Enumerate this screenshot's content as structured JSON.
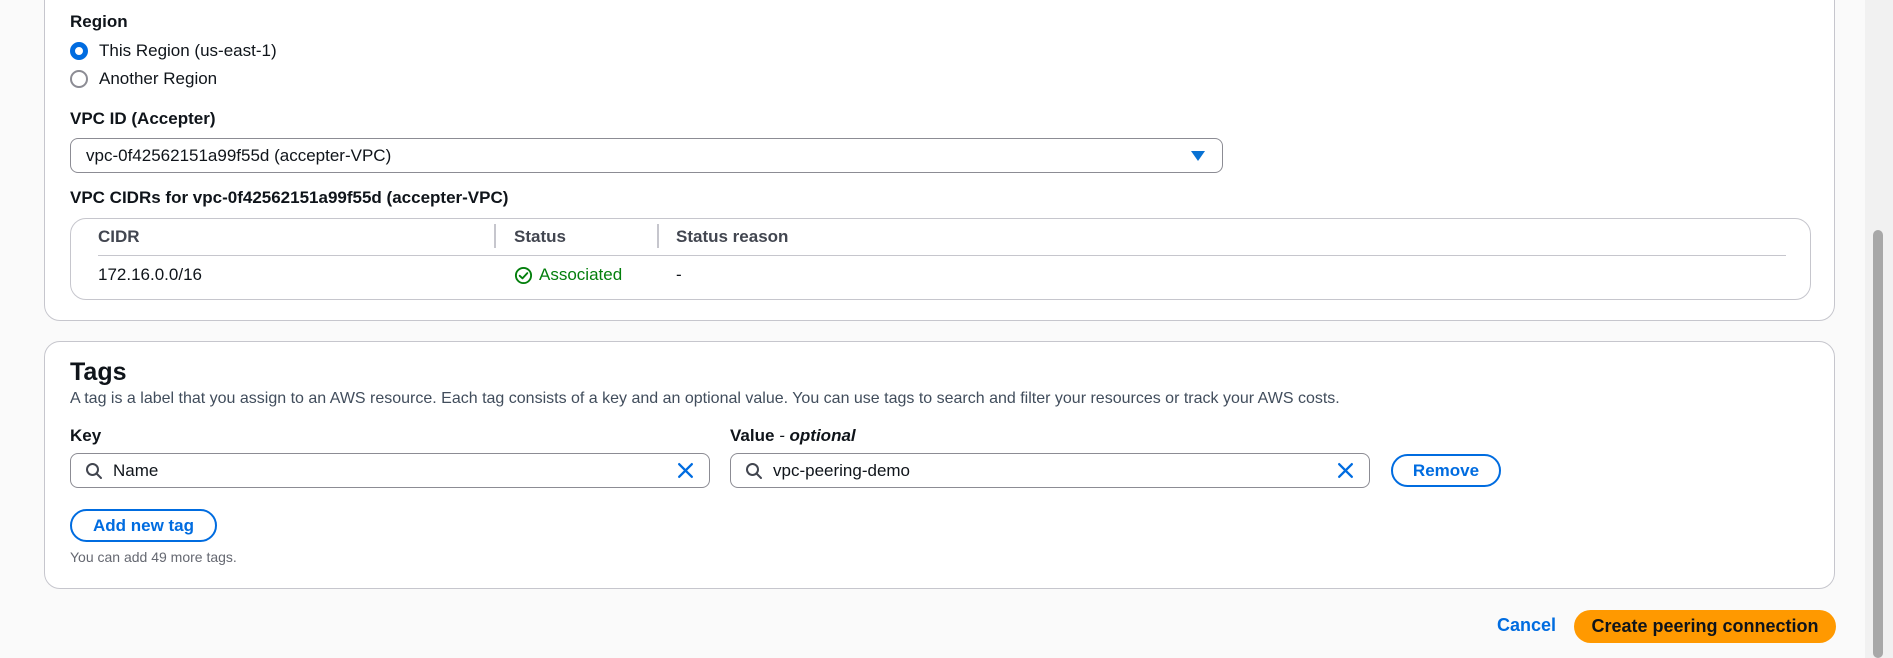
{
  "region": {
    "label": "Region",
    "options": [
      {
        "label": "This Region (us-east-1)",
        "checked": true
      },
      {
        "label": "Another Region",
        "checked": false
      }
    ]
  },
  "vpc_id": {
    "label": "VPC ID (Accepter)",
    "value": "vpc-0f42562151a99f55d (accepter-VPC)"
  },
  "cidrs": {
    "label": "VPC CIDRs for vpc-0f42562151a99f55d (accepter-VPC)",
    "columns": [
      "CIDR",
      "Status",
      "Status reason"
    ],
    "rows": [
      {
        "cidr": "172.16.0.0/16",
        "status": "Associated",
        "reason": "-"
      }
    ]
  },
  "tags": {
    "title": "Tags",
    "description": "A tag is a label that you assign to an AWS resource. Each tag consists of a key and an optional value. You can use tags to search and filter your resources or track your AWS costs.",
    "key_label": "Key",
    "value_label": "Value",
    "value_optional": "optional",
    "value_label_sep": " - ",
    "key_value": "Name",
    "value_value": "vpc-peering-demo",
    "remove_label": "Remove",
    "add_label": "Add new tag",
    "hint": "You can add 49 more tags."
  },
  "footer": {
    "cancel_label": "Cancel",
    "create_label": "Create peering connection"
  },
  "colors": {
    "accent": "#006ce0",
    "primary_button": "#ff9900",
    "success": "#037f0c"
  }
}
